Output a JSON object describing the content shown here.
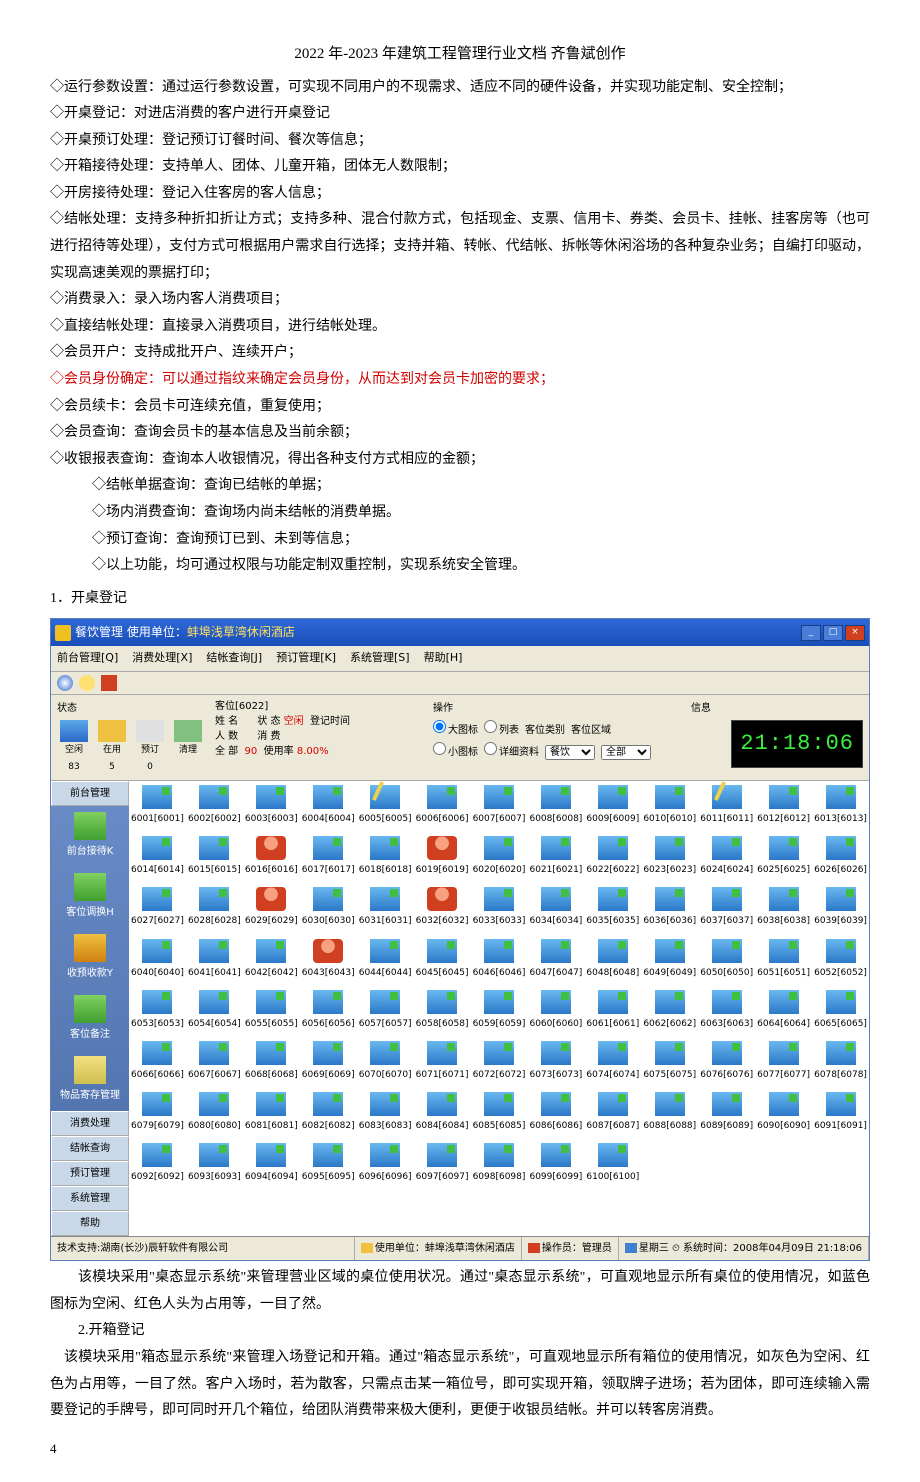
{
  "doc": {
    "title": "2022 年-2023 年建筑工程管理行业文档  齐鲁斌创作",
    "lines": [
      "◇运行参数设置：通过运行参数设置，可实现不同用户的不现需求、适应不同的硬件设备，并实现功能定制、安全控制；",
      "◇开桌登记：对进店消费的客户进行开桌登记",
      "◇开桌预订处理：登记预订订餐时间、餐次等信息；",
      "◇开箱接待处理：支持单人、团体、儿童开箱，团体无人数限制；",
      "◇开房接待处理：登记入住客房的客人信息；",
      "◇结帐处理：支持多种折扣折让方式；支持多种、混合付款方式，包括现金、支票、信用卡、券类、会员卡、挂帐、挂客房等（也可进行招待等处理），支付方式可根据用户需求自行选择；支持并箱、转帐、代结帐、拆帐等休闲浴场的各种复杂业务；自编打印驱动，实现高速美观的票据打印；",
      "◇消费录入：录入场内客人消费项目；",
      "◇直接结帐处理：直接录入消费项目，进行结帐处理。",
      "◇会员开户：支持成批开户、连续开户；",
      "◇会员身份确定：可以通过指纹来确定会员身份，从而达到对会员卡加密的要求；",
      "◇会员续卡：会员卡可连续充值，重复使用；",
      "◇会员查询：查询会员卡的基本信息及当前余额；",
      "◇收银报表查询：查询本人收银情况，得出各种支付方式相应的金额；",
      "◇结帐单据查询：查询已结帐的单据；",
      "◇场内消费查询：查询场内尚未结帐的消费单据。",
      "◇预订查询：查询预订已到、未到等信息；",
      "◇以上功能，均可通过权限与功能定制双重控制，实现系统安全管理。"
    ],
    "section1": "1．开桌登记",
    "after1_p1": "该模块采用\"桌态显示系统\"来管理营业区域的桌位使用状况。通过\"桌态显示系统\"，可直观地显示所有桌位的使用情况，如蓝色图标为空闲、红色人头为占用等，一目了然。",
    "section2": "2.开箱登记",
    "after2_p1": "该模块采用\"箱态显示系统\"来管理入场登记和开箱。通过\"箱态显示系统\"，可直观地显示所有箱位的使用情况，如灰色为空闲、红色为占用等，一目了然。客户入场时，若为散客，只需点击某一箱位号，即可实现开箱，领取牌子进场；若为团体，即可连续输入需要登记的手牌号，即可同时开几个箱位，给团队消费带来极大便利，更便于收银员结帐。并可以转客房消费。",
    "pagenum": "4"
  },
  "app": {
    "title_prefix": "餐饮管理    使用单位：",
    "title_unit": "蚌埠浅草湾休闲酒店",
    "menus": [
      "前台管理[Q]",
      "消费处理[X]",
      "结帐查询[J]",
      "预订管理[K]",
      "系统管理[S]",
      "帮助[H]"
    ],
    "status": {
      "label": "状态",
      "items": [
        "空闲",
        "在用",
        "预订",
        "清理"
      ],
      "counts": [
        "83",
        "5",
        "0",
        " "
      ]
    },
    "seatinfo": {
      "title": "客位[6022]",
      "rows": {
        "r1a": "姓  名",
        "r1b": "状  态",
        "r1bv": "空闲",
        "r1c": "登记时间",
        "r2a": "人  数",
        "r2b": "消  费",
        "r3a": "全  部",
        "r3av": "90",
        "r3b": "使用率",
        "r3bv": "8.00%"
      }
    },
    "ops": {
      "title": "操作",
      "big": "大图标",
      "list": "列表",
      "cat": "客位类别",
      "area": "客位区域",
      "small": "小图标",
      "detail": "详细资料",
      "sel1": "餐饮",
      "sel2": "全部"
    },
    "msg": {
      "title": "信息",
      "clock": "21:18:06"
    },
    "sidebar": {
      "cats": [
        "前台管理",
        "消费处理",
        "结帐查询",
        "预订管理",
        "系统管理",
        "帮助"
      ],
      "items": [
        "前台接待K",
        "客位调换H",
        "收预收款Y",
        "客位备注",
        "物品寄存管理"
      ]
    },
    "seats_special": {
      "6005": "pen",
      "6011": "pen",
      "6016": "occ",
      "6019": "occ",
      "6029": "occ",
      "6032": "occ",
      "6043": "occ"
    },
    "statusbar": {
      "tech": "技术支持:湖南(长沙)辰轩软件有限公司",
      "unit_lbl": "使用单位：",
      "unit_val": "蚌埠浅草湾休闲酒店",
      "op_lbl": "操作员：",
      "op_val": "管理员",
      "day": "星期三",
      "time_lbl": "系统时间：",
      "time_val": "2008年04月09日 21:18:06"
    }
  }
}
